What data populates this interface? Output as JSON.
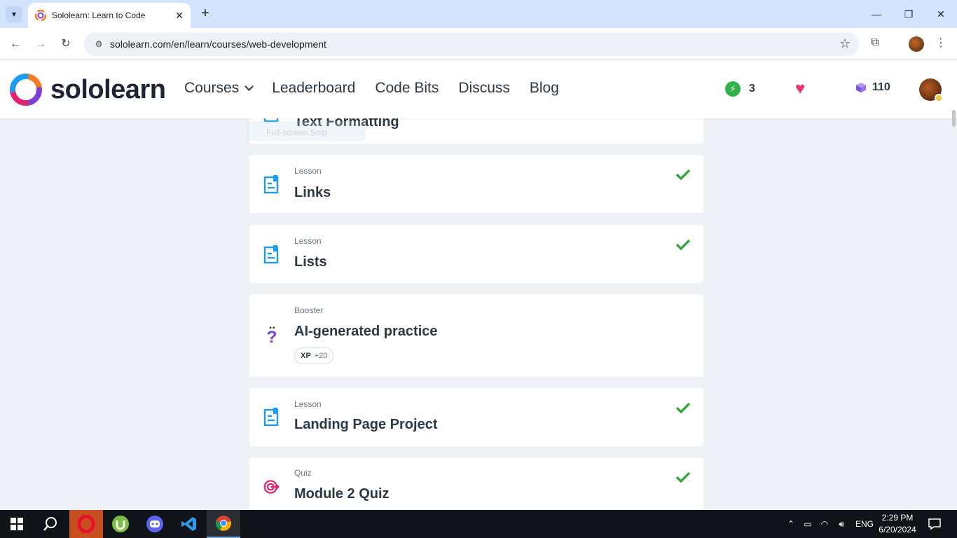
{
  "browser": {
    "tab_title": "Sololearn: Learn to Code",
    "url": "sololearn.com/en/learn/courses/web-development",
    "close_tab": "✕",
    "new_tab": "+"
  },
  "header": {
    "logo_text": "sololearn",
    "nav": [
      "Courses",
      "Leaderboard",
      "Code Bits",
      "Discuss",
      "Blog"
    ],
    "streak": "3",
    "gems": "110"
  },
  "snip_overlay": "Full-screen Snip",
  "cards": [
    {
      "type": "",
      "title": "Text Formatting",
      "completed": false
    },
    {
      "type": "Lesson",
      "title": "Links",
      "completed": true
    },
    {
      "type": "Lesson",
      "title": "Lists",
      "completed": true
    },
    {
      "type": "Booster",
      "title": "AI-generated practice",
      "completed": false,
      "xp_label": "XP",
      "xp_value": "+20"
    },
    {
      "type": "Lesson",
      "title": "Landing Page Project",
      "completed": true
    },
    {
      "type": "Quiz",
      "title": "Module 2 Quiz",
      "completed": true
    }
  ],
  "colors": {
    "accent_blue": "#1d9bf0",
    "check_green": "#2aa52f",
    "quiz_pink": "#e0246e",
    "booster_purple": "#7b3fd4"
  },
  "taskbar": {
    "language": "ENG",
    "time": "2:29 PM",
    "date": "6/20/2024"
  }
}
